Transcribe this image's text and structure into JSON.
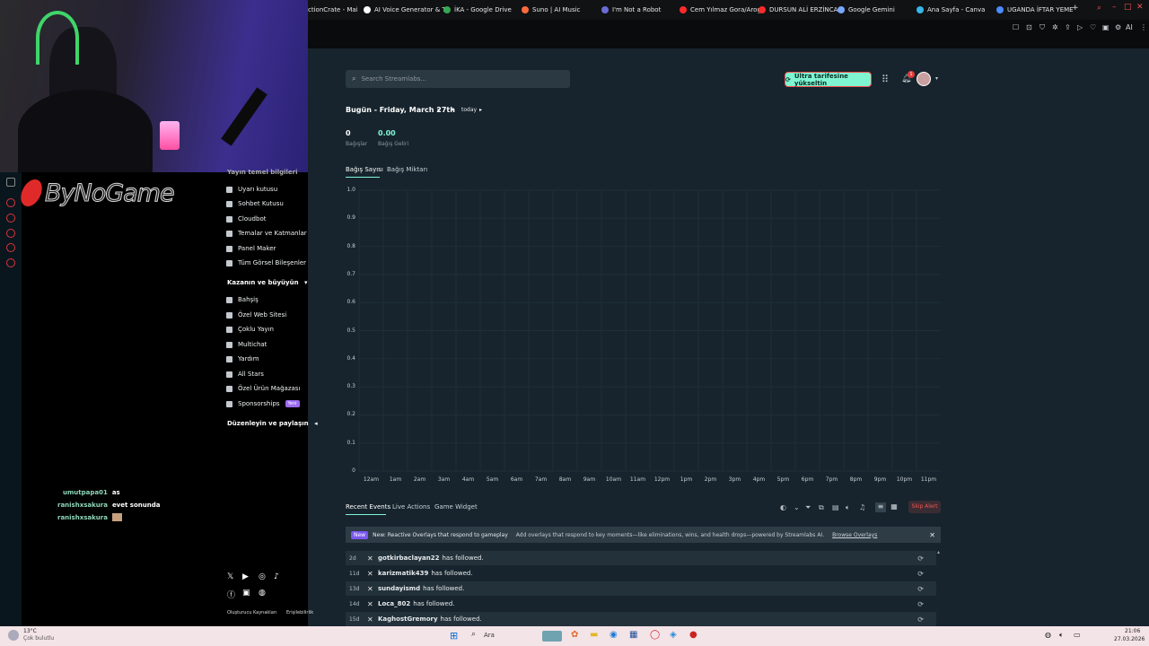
{
  "browser": {
    "tabs": [
      {
        "label": "ctionCrate - Mai",
        "color": "#ffffff"
      },
      {
        "label": "AI Voice Generator & T",
        "color": "#ffffff"
      },
      {
        "label": "İKA - Google Drive",
        "color": "#34a853"
      },
      {
        "label": "Suno | AI Music",
        "color": "#ff6a3d"
      },
      {
        "label": "I'm Not a Robot",
        "color": "#6b6bd6"
      },
      {
        "label": "Cem Yılmaz Gora/Arog",
        "color": "#ff2a2a"
      },
      {
        "label": "DURSUN ALİ ERZİNCA",
        "color": "#ff2a2a"
      },
      {
        "label": "Google Gemini",
        "color": "#7aa7ff"
      },
      {
        "label": "Ana Sayfa - Canva",
        "color": "#37b6e8"
      },
      {
        "label": "UGANDA İFTAR YEME",
        "color": "#4a8cff"
      }
    ],
    "new_tab": "+",
    "window_controls": [
      "–",
      "□",
      "✕"
    ],
    "toolbar_ai": "AI"
  },
  "search": {
    "placeholder": "Search Streamlabs..."
  },
  "header": {
    "upgrade_label": "Ultra tarifesine yükseltin",
    "notif_count": "1"
  },
  "date_nav": {
    "date_label": "Bugün - Friday, March 27th",
    "today_label": "today"
  },
  "stats": [
    {
      "value": "0",
      "label": "Bağışlar"
    },
    {
      "value": "0.00",
      "label": "Bağış Geliri"
    }
  ],
  "chart_tabs": [
    {
      "label": "Bağış Sayısı"
    },
    {
      "label": "Bağış Miktarı"
    }
  ],
  "chart_data": {
    "type": "line",
    "x": [
      "12am",
      "1am",
      "2am",
      "3am",
      "4am",
      "5am",
      "6am",
      "7am",
      "8am",
      "9am",
      "10am",
      "11am",
      "12pm",
      "1pm",
      "2pm",
      "3pm",
      "4pm",
      "5pm",
      "6pm",
      "7pm",
      "8pm",
      "9pm",
      "10pm",
      "11pm"
    ],
    "series": [
      {
        "values": []
      }
    ],
    "y_ticks": [
      "1.0",
      "0.9",
      "0.8",
      "0.7",
      "0.6",
      "0.5",
      "0.4",
      "0.3",
      "0.2",
      "0.1",
      "0"
    ],
    "ylim": [
      0,
      1
    ],
    "grid": true
  },
  "sidebar": {
    "partial_heading": "Yayın temel bilgileri",
    "group1": [
      "Uyarı kutusu",
      "Sohbet Kutusu",
      "Cloudbot",
      "Temalar ve Katmanlar",
      "Panel Maker",
      "Tüm Görsel Bileşenler"
    ],
    "group2_heading": "Kazanın ve büyüyün",
    "group2": [
      "Bahşiş",
      "Özel Web Sitesi",
      "Çoklu Yayın",
      "Multichat",
      "Yardım",
      "All Stars",
      "Özel Ürün Mağazası",
      "Sponsorships"
    ],
    "sponsorships_badge": "Yeni",
    "group3_heading": "Düzenleyin ve paylaşın",
    "footer_links": [
      "Oluşturucu Kaynakları",
      "Erişilebilirlik"
    ]
  },
  "events": {
    "tabs": [
      "Recent Events",
      "Live Actions",
      "Game Widget"
    ],
    "skip_alert": "Skip Alert",
    "banner": {
      "badge": "New",
      "text": "New: Reactive Overlays that respond to gameplay",
      "detail": "Add overlays that respond to key moments—like eliminations, wins, and health drops—powered by Streamlabs AI.",
      "link": "Browse Overlays"
    },
    "rows": [
      {
        "age": "2d",
        "name": "gotkirbaclayan22",
        "action": "has followed."
      },
      {
        "age": "11d",
        "name": "karizmatik439",
        "action": "has followed."
      },
      {
        "age": "13d",
        "name": "sundayismd",
        "action": "has followed."
      },
      {
        "age": "14d",
        "name": "Loca_802",
        "action": "has followed."
      },
      {
        "age": "15d",
        "name": "KaghostGremory",
        "action": "has followed."
      }
    ]
  },
  "stream_overlay": {
    "logo_text": "ByNoGame",
    "chat": [
      {
        "name": "umutpapa01",
        "msg": "as"
      },
      {
        "name": "ranishxsakura",
        "msg": "evet sonunda"
      },
      {
        "name": "ranishxsakura",
        "msg": ""
      }
    ]
  },
  "taskbar": {
    "weather_temp": "13°C",
    "weather_desc": "Çok bulutlu",
    "search_label": "Ara",
    "time": "21:06",
    "date": "27.03.2026"
  }
}
